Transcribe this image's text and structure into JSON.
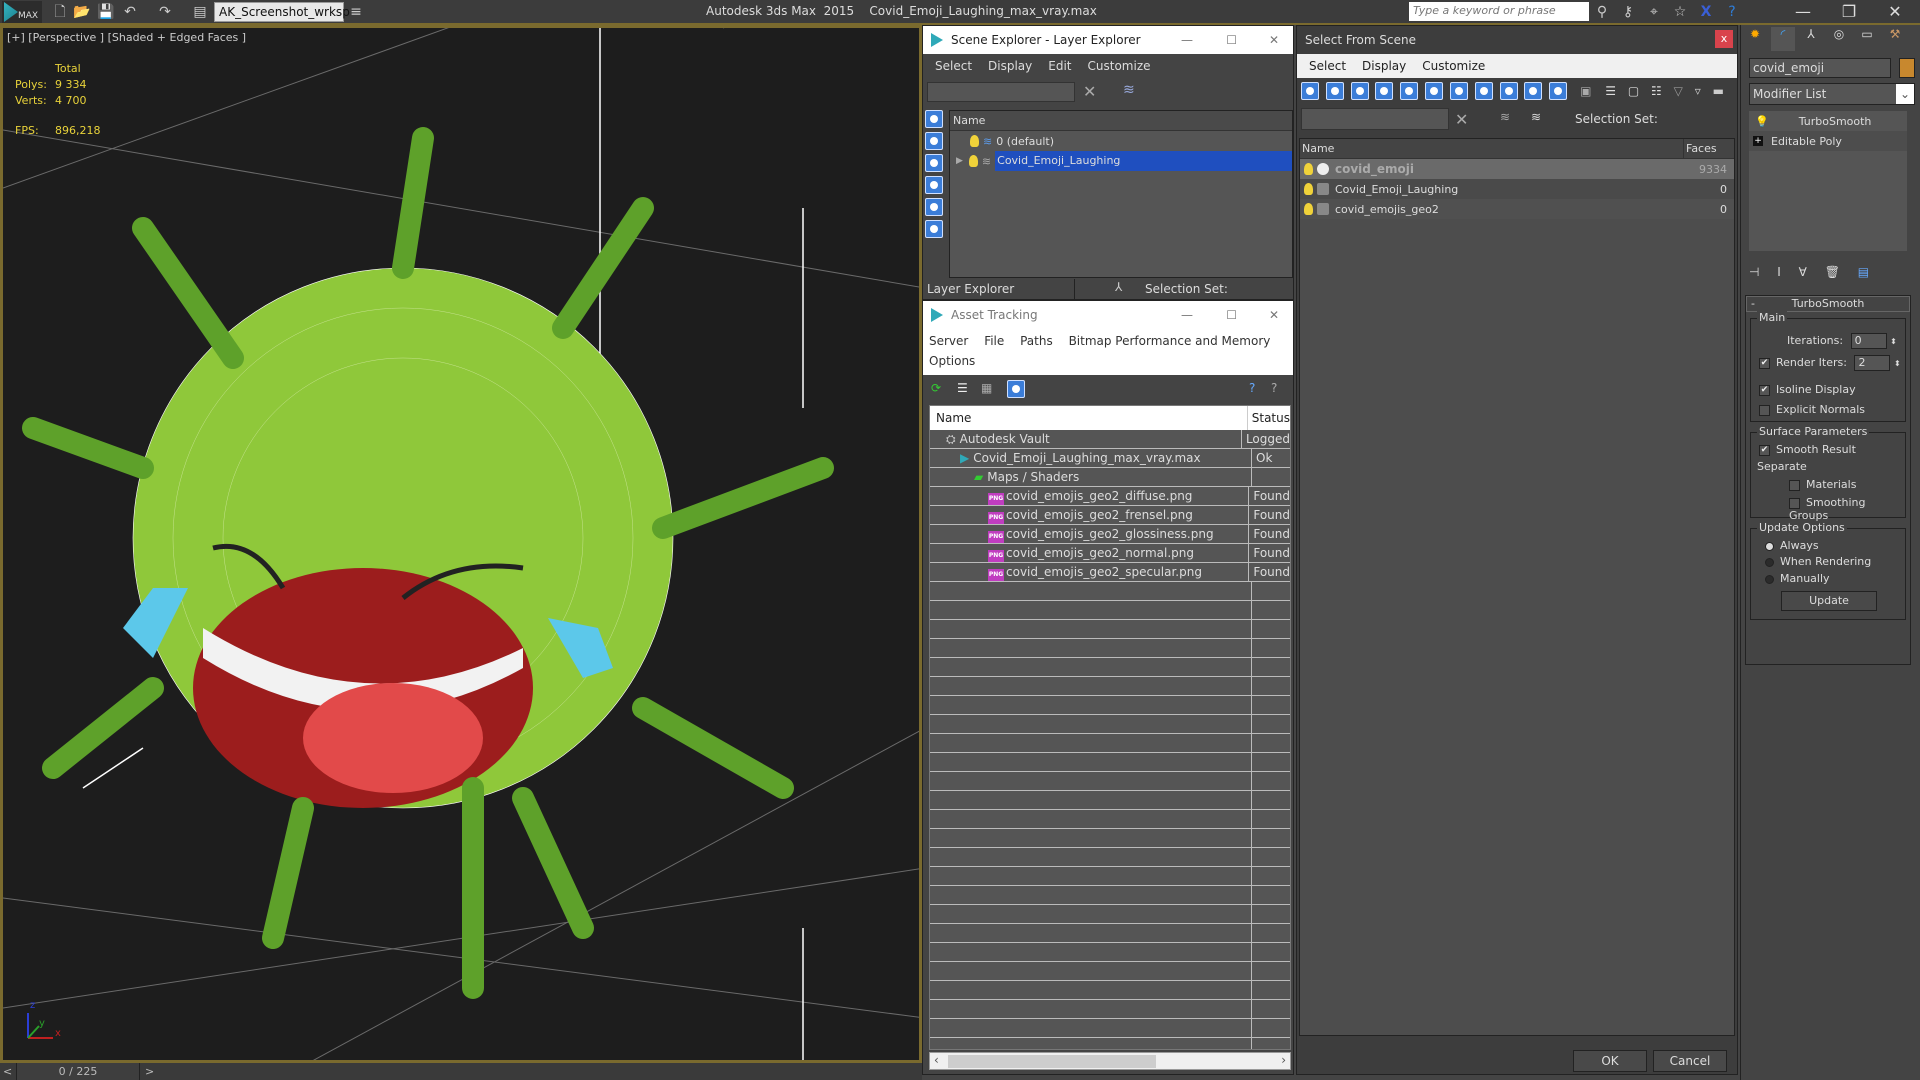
{
  "titlebar": {
    "app_logo": "MAX",
    "workspace": "AK_Screenshot_wrksp",
    "app_title": "Autodesk 3ds Max  2015    Covid_Emoji_Laughing_max_vray.max",
    "search_placeholder": "Type a keyword or phrase",
    "icons": [
      "new-file-icon",
      "open-icon",
      "save-icon",
      "undo-icon",
      "redo-icon",
      "project-icon"
    ],
    "right_icons": [
      "binoculars-icon",
      "key-icon",
      "satellite-icon",
      "star-icon",
      "x-exchange-icon",
      "help-icon"
    ]
  },
  "viewport": {
    "label": "[+] [Perspective ] [Shaded + Edged Faces ]",
    "stats": {
      "header": "Total",
      "polys_label": "Polys:",
      "polys": "9 334",
      "verts_label": "Verts:",
      "verts": "4 700"
    },
    "fps_label": "FPS:",
    "fps": "896,218",
    "axis": {
      "x": "x",
      "y": "y",
      "z": "z"
    }
  },
  "timeslider": {
    "value": "0 / 225",
    "prev": "<",
    "next": ">"
  },
  "scene_explorer": {
    "title": "Scene Explorer - Layer Explorer",
    "menu": [
      "Select",
      "Display",
      "Edit",
      "Customize"
    ],
    "column": "Name",
    "rows": [
      {
        "name": "0 (default)",
        "selected": false
      },
      {
        "name": "Covid_Emoji_Laughing",
        "selected": true
      }
    ],
    "footer_dropdown": "Layer Explorer",
    "selection_set_label": "Selection Set:"
  },
  "asset_tracking": {
    "title": "Asset Tracking",
    "menu": [
      "Server",
      "File",
      "Paths",
      "Bitmap Performance and Memory",
      "Options"
    ],
    "columns": [
      "Name",
      "Status"
    ],
    "rows": [
      {
        "name": "Autodesk Vault",
        "status": "Logged",
        "indent": 0,
        "icon": "vault-icon"
      },
      {
        "name": "Covid_Emoji_Laughing_max_vray.max",
        "status": "Ok",
        "indent": 1,
        "icon": "max-file-icon"
      },
      {
        "name": "Maps / Shaders",
        "status": "",
        "indent": 2,
        "icon": "maps-icon"
      },
      {
        "name": "covid_emojis_geo2_diffuse.png",
        "status": "Found",
        "indent": 3,
        "icon": "png-icon"
      },
      {
        "name": "covid_emojis_geo2_frensel.png",
        "status": "Found",
        "indent": 3,
        "icon": "png-icon"
      },
      {
        "name": "covid_emojis_geo2_glossiness.png",
        "status": "Found",
        "indent": 3,
        "icon": "png-icon"
      },
      {
        "name": "covid_emojis_geo2_normal.png",
        "status": "Found",
        "indent": 3,
        "icon": "png-icon"
      },
      {
        "name": "covid_emojis_geo2_specular.png",
        "status": "Found",
        "indent": 3,
        "icon": "png-icon"
      }
    ]
  },
  "select_from_scene": {
    "title": "Select From Scene",
    "menu": [
      "Select",
      "Display",
      "Customize"
    ],
    "selection_set_label": "Selection Set:",
    "columns": [
      "Name",
      "Faces"
    ],
    "rows": [
      {
        "name": "covid_emoji",
        "faces": "9334",
        "selected": true
      },
      {
        "name": "Covid_Emoji_Laughing",
        "faces": "0",
        "selected": false
      },
      {
        "name": "covid_emojis_geo2",
        "faces": "0",
        "selected": false
      }
    ],
    "ok": "OK",
    "cancel": "Cancel"
  },
  "command_panel": {
    "object_name": "covid_emoji",
    "object_color": "#c8882e",
    "modifier_list": "Modifier List",
    "stack": [
      "TurboSmooth",
      "Editable Poly"
    ],
    "rollout_title": "TurboSmooth",
    "main_group": "Main",
    "iterations_label": "Iterations:",
    "iterations": "0",
    "render_iters_label": "Render Iters:",
    "render_iters": "2",
    "render_iters_checked": true,
    "isoline_label": "Isoline Display",
    "isoline_checked": true,
    "explicit_normals_label": "Explicit Normals",
    "explicit_normals_checked": false,
    "surface_group": "Surface Parameters",
    "smooth_result_label": "Smooth Result",
    "smooth_result_checked": true,
    "separate_label": "Separate",
    "materials_label": "Materials",
    "smoothing_groups_label": "Smoothing Groups",
    "update_group": "Update Options",
    "update_options": [
      "Always",
      "When Rendering",
      "Manually"
    ],
    "update_selected": "Always",
    "update_button": "Update"
  }
}
